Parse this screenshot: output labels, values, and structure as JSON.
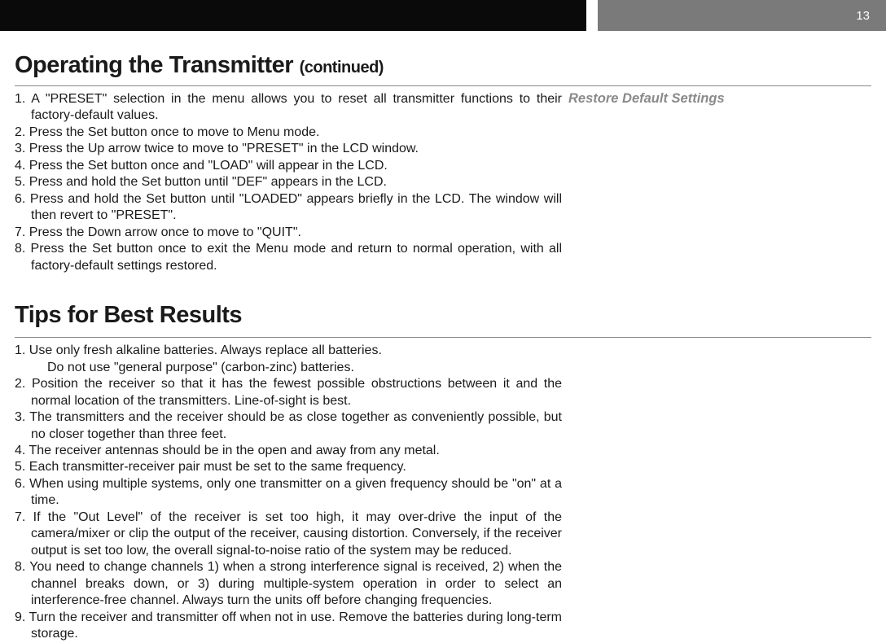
{
  "page_number": "13",
  "section1": {
    "title_main": "Operating the Transmitter",
    "title_continued": "(continued)",
    "side_heading": "Restore Default Settings",
    "items": [
      "1. A \"PRESET\" selection in the menu allows you to reset all transmitter functions to their factory-default values.",
      "2. Press the Set button once to move to Menu mode.",
      "3. Press the Up arrow twice to move to \"PRESET\" in the LCD window.",
      "4. Press the Set button once and \"LOAD\" will appear in the LCD.",
      "5. Press and hold the Set button until \"DEF\" appears in the LCD.",
      "6. Press and hold the Set button until \"LOADED\" appears briefly in the LCD. The window will then revert to \"PRESET\".",
      "7. Press the Down arrow once to move to \"QUIT\".",
      "8. Press the Set button once to exit the Menu mode and return to normal operation, with all factory-default settings restored."
    ]
  },
  "section2": {
    "title": "Tips for Best Results",
    "items": [
      {
        "main": "1. Use only fresh alkaline batteries. Always replace all batteries.",
        "sub": "Do not use \"general purpose\" (carbon-zinc) batteries."
      },
      {
        "main": "2. Position the receiver so that it has the fewest possible obstructions between it and the normal location of the transmitters. Line-of-sight is best."
      },
      {
        "main": "3. The transmitters and the receiver should be as close together as conveniently possible, but no closer together than three feet."
      },
      {
        "main": "4. The receiver antennas should be in the open and away from any metal."
      },
      {
        "main": "5. Each transmitter-receiver pair must be set to the same frequency."
      },
      {
        "main": "6. When using multiple systems, only one transmitter on a given frequency should be \"on\" at a time."
      },
      {
        "main": "7. If the \"Out Level\" of the receiver is set too high, it may over-drive the input of the camera/mixer or clip the output of the receiver, causing distortion. Conversely, if the receiver output is set too low, the overall signal-to-noise ratio of the system may be reduced."
      },
      {
        "main": "8. You need to change channels 1) when a strong interference signal is received, 2) when the channel breaks down, or 3) during multiple-system operation in order to select an interference-free channel. Always turn the units off before changing frequencies."
      },
      {
        "main": "9. Turn the receiver and transmitter off when not in use. Remove the batteries during long-term storage."
      }
    ]
  }
}
